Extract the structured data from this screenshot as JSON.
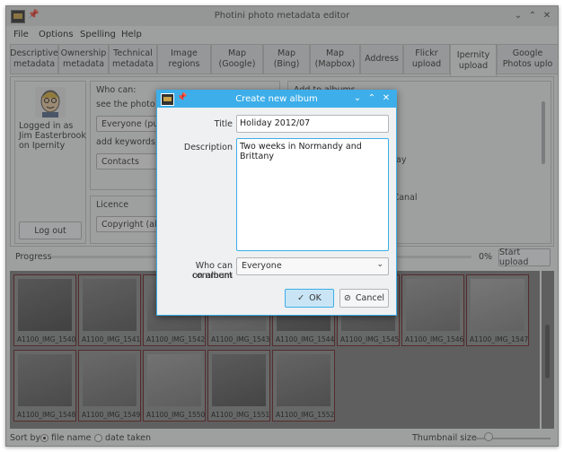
{
  "window": {
    "title": "Photini photo metadata editor"
  },
  "menu": [
    "File",
    "Options",
    "Spelling",
    "Help"
  ],
  "tabs": [
    {
      "line1": "Descriptive",
      "line2": "metadata"
    },
    {
      "line1": "Ownership",
      "line2": "metadata"
    },
    {
      "line1": "Technical",
      "line2": "metadata"
    },
    {
      "line1": "Image",
      "line2": "regions"
    },
    {
      "line1": "Map",
      "line2": "(Google)"
    },
    {
      "line1": "Map",
      "line2": "(Bing)"
    },
    {
      "line1": "Map",
      "line2": "(Mapbox)"
    },
    {
      "line1": "Address",
      "line2": ""
    },
    {
      "line1": "Flickr",
      "line2": "upload"
    },
    {
      "line1": "Ipernity",
      "line2": "upload"
    },
    {
      "line1": "Google",
      "line2": "Photos uplo"
    }
  ],
  "account": {
    "line1": "Logged in as",
    "line2": "Jim Easterbrook",
    "line3": "on Ipernity",
    "logout": "Log out"
  },
  "perms": {
    "who_can": "Who can:",
    "see_photo": "see the photo",
    "see_value": "Everyone (public)",
    "add_keywords": "add keywords, no",
    "contacts": "Contacts",
    "licence": "Licence",
    "licence_value": "Copyright (all rig"
  },
  "albums": {
    "add_to": "Add to albums",
    "partial1": "ay",
    "partial2": "'s Canal"
  },
  "progress": {
    "label": "Progress",
    "percent_text": "0%",
    "value": 0,
    "start": "Start upload"
  },
  "thumbnails": [
    "A1100_IMG_1540",
    "A1100_IMG_1541",
    "A1100_IMG_1542",
    "A1100_IMG_1543",
    "A1100_IMG_1544",
    "A1100_IMG_1545",
    "A1100_IMG_1546",
    "A1100_IMG_1547",
    "A1100_IMG_1548",
    "A1100_IMG_1549",
    "A1100_IMG_1550",
    "A1100_IMG_1551",
    "A1100_IMG_1552"
  ],
  "sortbar": {
    "sort_by": "Sort by",
    "file_name": "file name",
    "date_taken": "date taken",
    "thumb_size": "Thumbnail size"
  },
  "dialog": {
    "title": "Create new album",
    "title_label": "Title",
    "title_value": "Holiday 2012/07",
    "desc_label": "Description",
    "desc_value": "Two weeks in Normandy and Brittany",
    "comment_label1": "Who can comment",
    "comment_label2": "on album",
    "comment_value": "Everyone",
    "ok": "OK",
    "cancel": "Cancel"
  },
  "colors": {
    "accent": "#3daee9",
    "selection_border": "#6a2020"
  }
}
